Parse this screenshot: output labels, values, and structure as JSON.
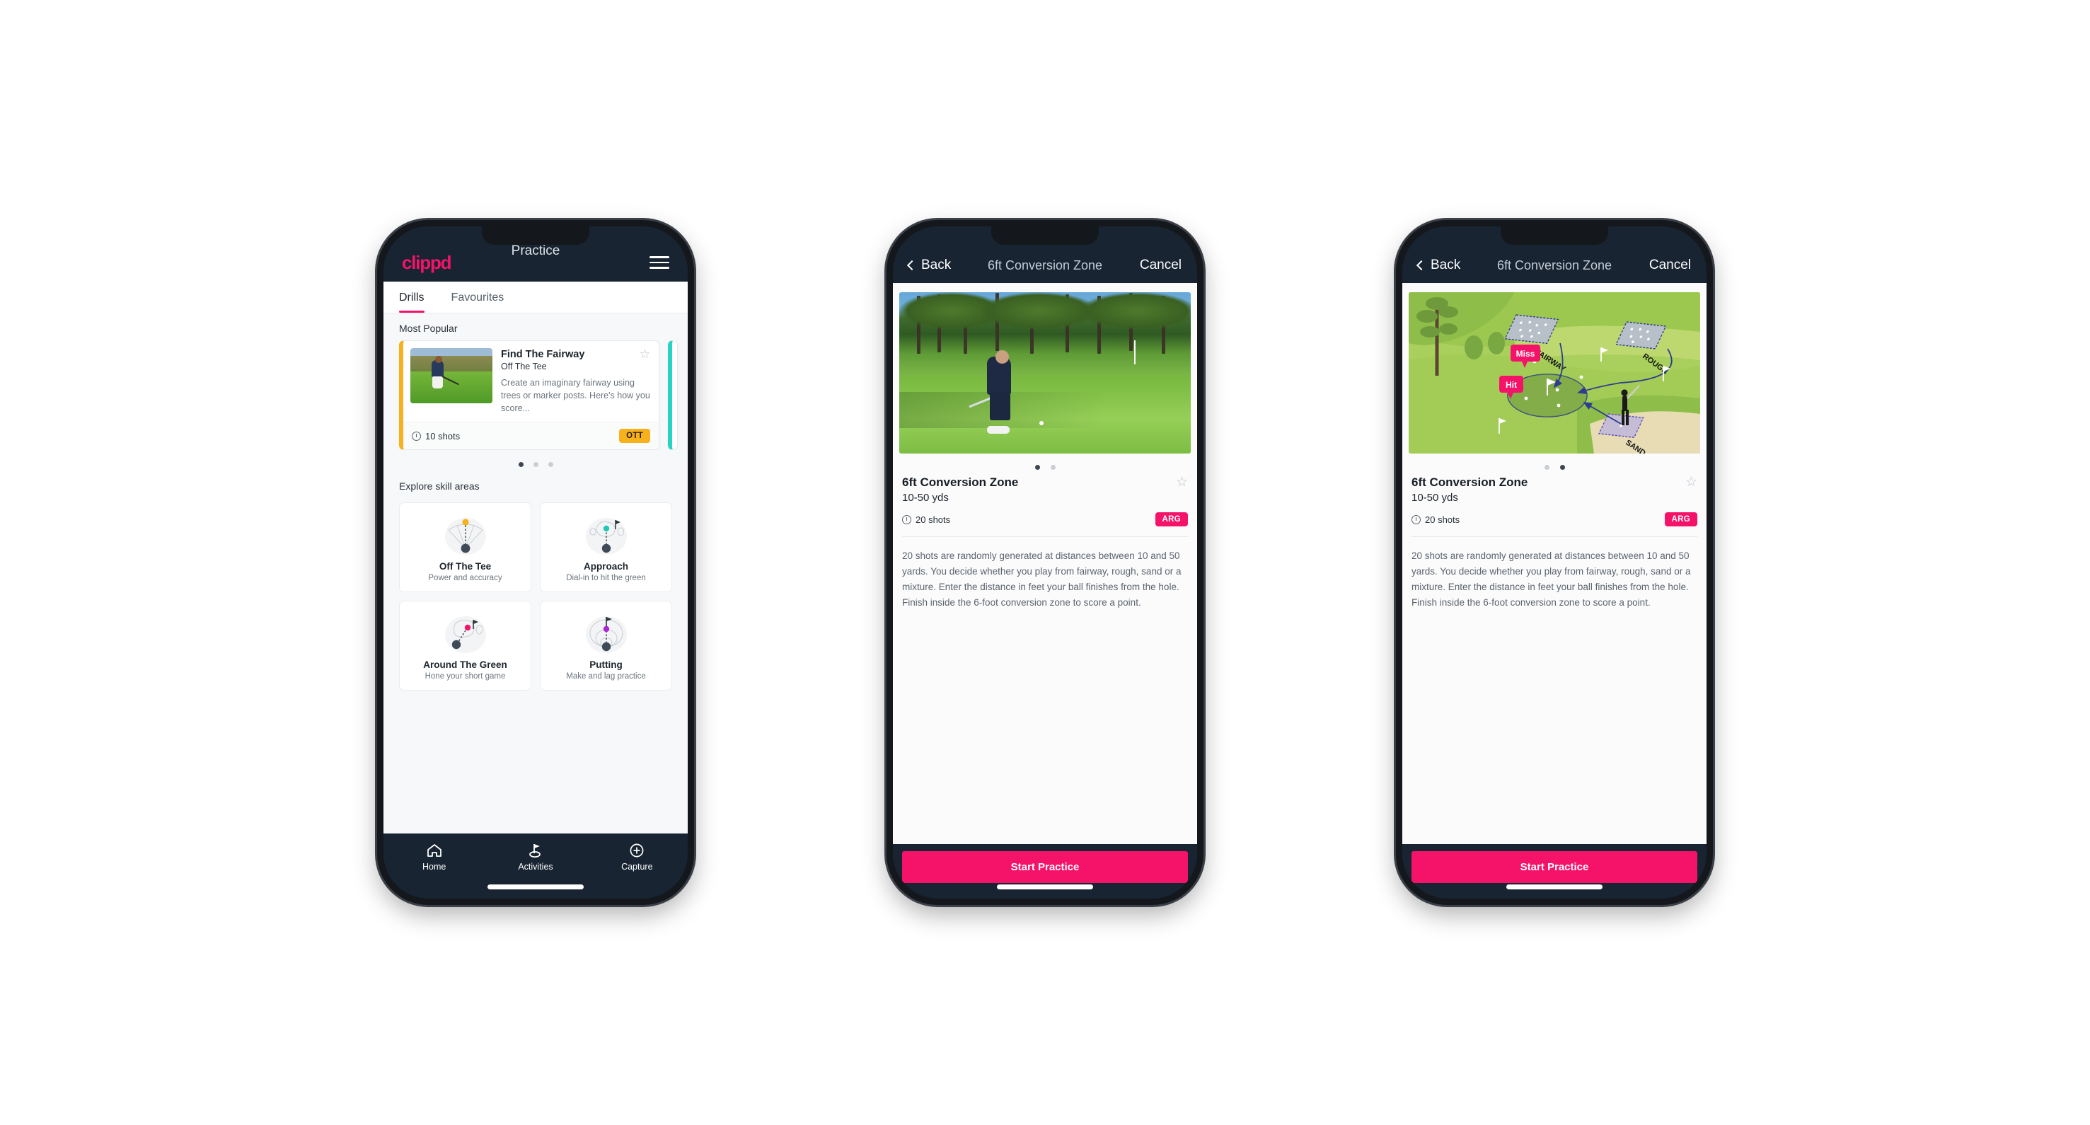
{
  "app": {
    "brand": "clippd",
    "accent_pink": "#f5136a",
    "dark_navy": "#182432",
    "badge_ott_color": "#f6b11c",
    "badge_arg_color": "#f5136a"
  },
  "phone1": {
    "appbar": {
      "brand": "clippd",
      "title": "Practice",
      "menu_icon": "hamburger-menu-icon"
    },
    "tabs": [
      {
        "label": "Drills",
        "active": true
      },
      {
        "label": "Favourites",
        "active": false
      }
    ],
    "most_popular": {
      "section_title": "Most Popular",
      "card": {
        "title": "Find The Fairway",
        "subtitle": "Off The Tee",
        "description": "Create an imaginary fairway using trees or marker posts. Here's how you score...",
        "shots": "10 shots",
        "badge": "OTT",
        "badge_color": "#f6b11c",
        "favourite_icon": "star-outline-icon",
        "accent_bar_color": "#f6b11c"
      },
      "next_card_accent_color": "#27d3c3",
      "dots": {
        "count": 3,
        "active_index": 0
      }
    },
    "skill_areas": {
      "section_title": "Explore skill areas",
      "cards": [
        {
          "name": "Off The Tee",
          "desc": "Power and accuracy",
          "icon": "tee-fan-icon",
          "dot_color": "#f6b11c"
        },
        {
          "name": "Approach",
          "desc": "Dial-in to hit the green",
          "icon": "green-approach-icon",
          "dot_color": "#1fc9b6"
        },
        {
          "name": "Around The Green",
          "desc": "Hone your short game",
          "icon": "chip-green-icon",
          "dot_color": "#f5136a"
        },
        {
          "name": "Putting",
          "desc": "Make and lag practice",
          "icon": "putting-rings-icon",
          "dot_color": "#a927d6"
        }
      ]
    },
    "tabbar": [
      {
        "label": "Home",
        "icon": "home-icon",
        "active": false
      },
      {
        "label": "Activities",
        "icon": "golf-flag-icon",
        "active": true
      },
      {
        "label": "Capture",
        "icon": "plus-circle-icon",
        "active": false
      }
    ]
  },
  "phone2": {
    "navbar": {
      "back": "Back",
      "title": "6ft Conversion Zone",
      "cancel": "Cancel",
      "back_icon": "chevron-left-icon"
    },
    "media": {
      "type": "photo",
      "alt": "golfer chipping on fairway with pine trees"
    },
    "dots": {
      "count": 2,
      "active_index": 0
    },
    "detail": {
      "title": "6ft Conversion Zone",
      "distance": "10-50 yds",
      "shots": "20 shots",
      "badge": "ARG",
      "badge_color": "#f5136a",
      "favourite_icon": "star-outline-icon",
      "description": "20 shots are randomly generated at distances between 10 and 50 yards. You decide whether you play from fairway, rough, sand or a mixture. Enter the distance in feet your ball finishes from the hole. Finish inside the 6-foot conversion zone to score a point."
    },
    "cta": "Start Practice"
  },
  "phone3": {
    "navbar": {
      "back": "Back",
      "title": "6ft Conversion Zone",
      "cancel": "Cancel",
      "back_icon": "chevron-left-icon"
    },
    "media": {
      "type": "illustration",
      "alt": "isometric golf hole diagram",
      "labels": [
        "FAIRWAY",
        "ROUGH",
        "SAND"
      ],
      "markers": [
        "Miss",
        "Hit"
      ]
    },
    "dots": {
      "count": 2,
      "active_index": 1
    },
    "detail": {
      "title": "6ft Conversion Zone",
      "distance": "10-50 yds",
      "shots": "20 shots",
      "badge": "ARG",
      "badge_color": "#f5136a",
      "favourite_icon": "star-outline-icon",
      "description": "20 shots are randomly generated at distances between 10 and 50 yards. You decide whether you play from fairway, rough, sand or a mixture. Enter the distance in feet your ball finishes from the hole. Finish inside the 6-foot conversion zone to score a point."
    },
    "cta": "Start Practice"
  }
}
